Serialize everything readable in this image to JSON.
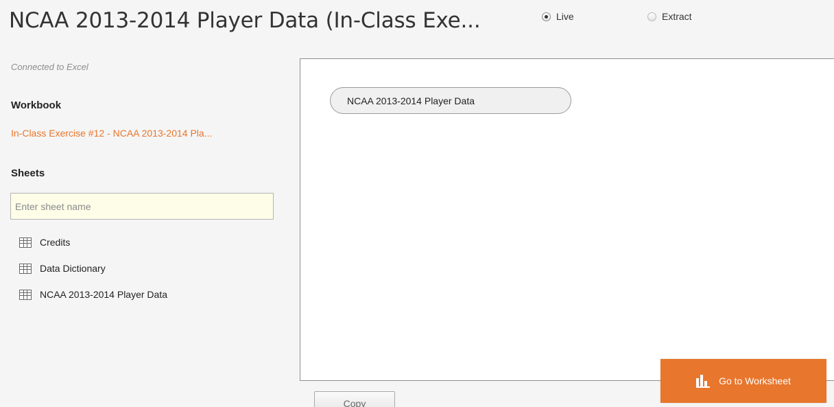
{
  "header": {
    "title": "NCAA 2013-2014 Player Data (In-Class Exe...",
    "connection_modes": [
      {
        "label": "Live",
        "selected": true
      },
      {
        "label": "Extract",
        "selected": false
      }
    ]
  },
  "sidebar": {
    "connected_text": "Connected to Excel",
    "workbook_heading": "Workbook",
    "workbook_name": "In-Class Exercise #12 - NCAA 2013-2014 Pla...",
    "sheets_heading": "Sheets",
    "search_placeholder": "Enter sheet name",
    "sheets": [
      {
        "label": "Credits",
        "icon": "table-icon"
      },
      {
        "label": "Data Dictionary",
        "icon": "table-icon"
      },
      {
        "label": "NCAA 2013-2014 Player Data",
        "icon": "table-icon"
      }
    ]
  },
  "canvas": {
    "table_label": "NCAA 2013-2014 Player Data"
  },
  "actions": {
    "copy_label": "Copy",
    "goto_label": "Go to Worksheet",
    "goto_icon": "worksheet-chart-icon"
  },
  "colors": {
    "accent": "#e8762d",
    "background": "#f5f5f5",
    "search_bg": "#fdfde8"
  }
}
